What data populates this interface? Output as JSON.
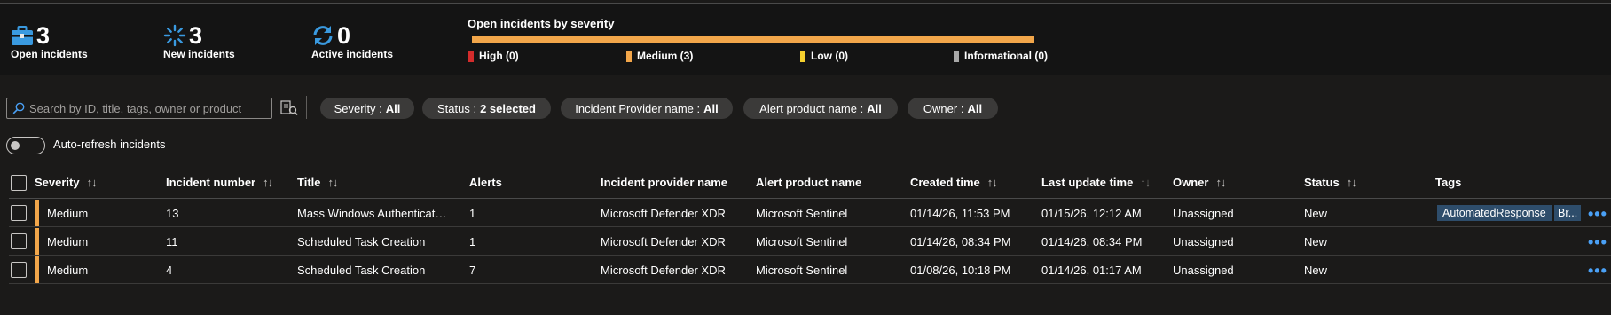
{
  "summary": {
    "open": {
      "count": "3",
      "label": "Open incidents",
      "icon": "briefcase-icon",
      "color": "#3a9ae0"
    },
    "new": {
      "count": "3",
      "label": "New incidents",
      "icon": "loading-spinner-icon",
      "color": "#3a9ae0"
    },
    "active": {
      "count": "0",
      "label": "Active incidents",
      "icon": "refresh-icon",
      "color": "#3a9ae0"
    },
    "severity": {
      "title": "Open incidents by severity",
      "bar_color": "#f2a64a",
      "legend": [
        {
          "label": "High (0)",
          "color": "#d42c2c"
        },
        {
          "label": "Medium (3)",
          "color": "#f2a64a"
        },
        {
          "label": "Low (0)",
          "color": "#f5d02e"
        },
        {
          "label": "Informational (0)",
          "color": "#a8a8a8"
        }
      ]
    }
  },
  "toolbar": {
    "search_placeholder": "Search by ID, title, tags, owner or product",
    "filters": [
      {
        "name": "Severity :",
        "value": "All"
      },
      {
        "name": "Status :",
        "value": "2 selected"
      },
      {
        "name": "Incident Provider name :",
        "value": "All"
      },
      {
        "name": "Alert product name :",
        "value": "All"
      },
      {
        "name": "Owner :",
        "value": "All"
      }
    ],
    "auto_refresh_label": "Auto-refresh incidents",
    "auto_refresh_on": false
  },
  "table": {
    "columns": [
      "Severity",
      "Incident number",
      "Title",
      "Alerts",
      "Incident provider name",
      "Alert product name",
      "Created time",
      "Last update time",
      "Owner",
      "Status",
      "Tags"
    ],
    "rows": [
      {
        "severity": "Medium",
        "number": "13",
        "title": "Mass Windows Authentication Attempts",
        "alerts": "1",
        "provider": "Microsoft Defender XDR",
        "product": "Microsoft Sentinel",
        "created": "01/14/26, 11:53 PM",
        "updated": "01/15/26, 12:12 AM",
        "owner": "Unassigned",
        "status": "New",
        "tags": [
          "AutomatedResponse",
          "Br..."
        ]
      },
      {
        "severity": "Medium",
        "number": "11",
        "title": "Scheduled Task Creation",
        "alerts": "1",
        "provider": "Microsoft Defender XDR",
        "product": "Microsoft Sentinel",
        "created": "01/14/26, 08:34 PM",
        "updated": "01/14/26, 08:34 PM",
        "owner": "Unassigned",
        "status": "New",
        "tags": []
      },
      {
        "severity": "Medium",
        "number": "4",
        "title": "Scheduled Task Creation",
        "alerts": "7",
        "provider": "Microsoft Defender XDR",
        "product": "Microsoft Sentinel",
        "created": "01/08/26, 10:18 PM",
        "updated": "01/14/26, 01:17 AM",
        "owner": "Unassigned",
        "status": "New",
        "tags": []
      }
    ],
    "more_label": "•••",
    "severity_color": "#f2a64a"
  }
}
